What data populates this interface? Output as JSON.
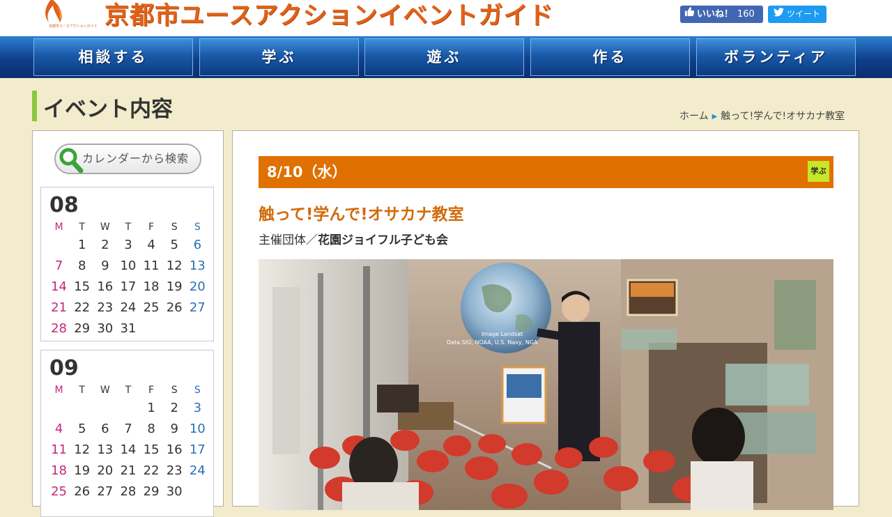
{
  "header": {
    "site_title": "京都市ユースアクションイベントガイド",
    "logo_caption": "京都市ユースアクションガイド",
    "fb_like_label": "いいね！",
    "fb_like_count": "160",
    "tweet_label": "ツイート",
    "colors": {
      "title": "#e0621a",
      "fb": "#4267b2",
      "twitter": "#1d9bf0"
    }
  },
  "nav": {
    "items": [
      {
        "label": "相談する"
      },
      {
        "label": "学ぶ"
      },
      {
        "label": "遊ぶ"
      },
      {
        "label": "作る"
      },
      {
        "label": "ボランティア"
      }
    ]
  },
  "page": {
    "heading": "イベント内容",
    "breadcrumb": {
      "home": "ホーム",
      "current": "触って!学んで!オサカナ教室"
    }
  },
  "sidebar": {
    "calendar_search_label": "カレンダーから検索",
    "weekday_headers": [
      "M",
      "T",
      "W",
      "T",
      "F",
      "S",
      "S"
    ],
    "calendars": [
      {
        "month": "08",
        "weeks": [
          [
            "",
            "1",
            "2",
            "3",
            "4",
            "5",
            "6"
          ],
          [
            "7",
            "8",
            "9",
            "10",
            "11",
            "12",
            "13"
          ],
          [
            "14",
            "15",
            "16",
            "17",
            "18",
            "19",
            "20"
          ],
          [
            "21",
            "22",
            "23",
            "24",
            "25",
            "26",
            "27"
          ],
          [
            "28",
            "29",
            "30",
            "31",
            "",
            "",
            ""
          ]
        ]
      },
      {
        "month": "09",
        "weeks": [
          [
            "",
            "",
            "",
            "",
            "1",
            "2",
            "3"
          ],
          [
            "4",
            "5",
            "6",
            "7",
            "8",
            "9",
            "10"
          ],
          [
            "11",
            "12",
            "13",
            "14",
            "15",
            "16",
            "17"
          ],
          [
            "18",
            "19",
            "20",
            "21",
            "22",
            "23",
            "24"
          ],
          [
            "25",
            "26",
            "27",
            "28",
            "29",
            "30",
            ""
          ]
        ]
      }
    ]
  },
  "event": {
    "date": "8/10（水）",
    "category_badge": "学ぶ",
    "title": "触って!学んで!オサカナ教室",
    "organizer_prefix": "主催団体／",
    "organizer_name": "花園ジョイフル子ども会",
    "photo_overlay_text": [
      "Image Landsat",
      "Data SIO, NOAA, U.S. Navy, NGA"
    ],
    "colors": {
      "date_bar": "#e07000",
      "badge": "#c7e62a",
      "title": "#d26a0a"
    }
  }
}
